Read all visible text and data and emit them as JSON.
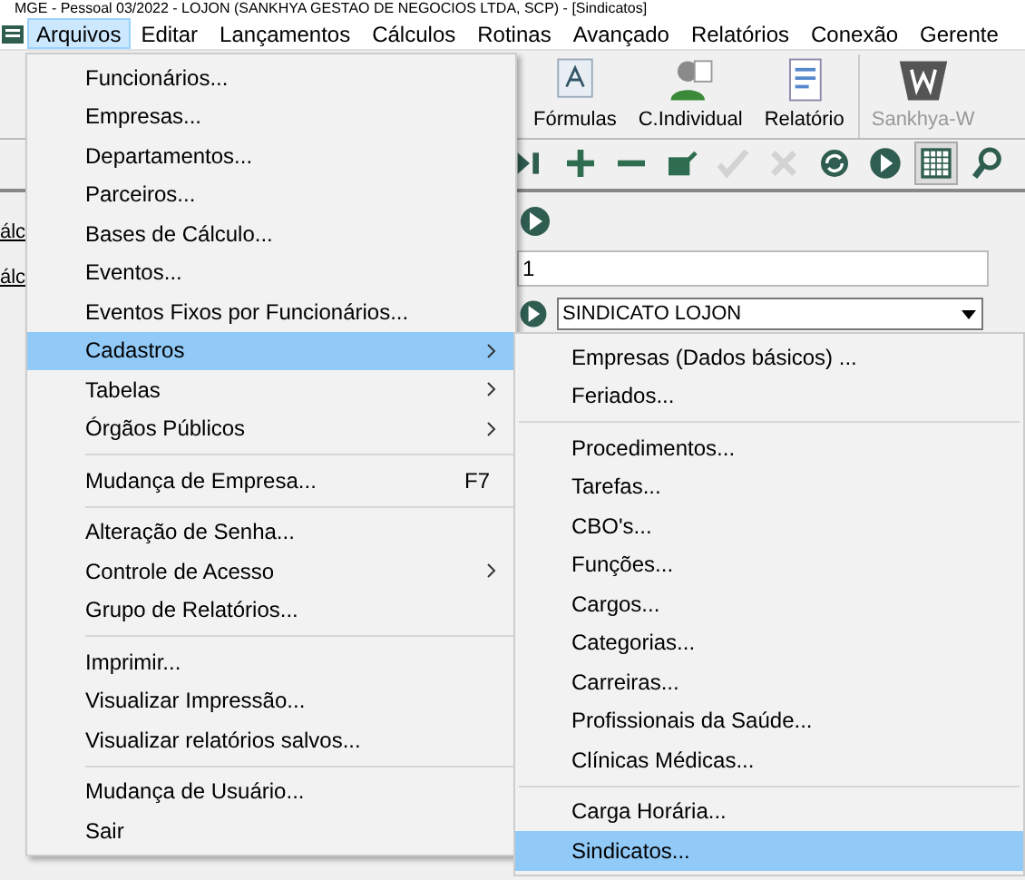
{
  "window": {
    "title": "MGE - Pessoal 03/2022 - LOJON (SANKHYA GESTAO DE NEGOCIOS LTDA, SCP) - [Sindicatos]"
  },
  "menu_bar": [
    {
      "label": "Arquivos",
      "selected": true
    },
    {
      "label": "Editar",
      "selected": false
    },
    {
      "label": "Lançamentos",
      "selected": false
    },
    {
      "label": "Cálculos",
      "selected": false
    },
    {
      "label": "Rotinas",
      "selected": false
    },
    {
      "label": "Avançado",
      "selected": false
    },
    {
      "label": "Relatórios",
      "selected": false
    },
    {
      "label": "Conexão",
      "selected": false
    },
    {
      "label": "Gerente",
      "selected": false
    }
  ],
  "toolbar": {
    "buttons": [
      {
        "kind": "formula",
        "label": "Fórmulas",
        "disabled": false
      },
      {
        "kind": "person",
        "label": "C.Individual",
        "disabled": false
      },
      {
        "kind": "report",
        "label": "Relatório",
        "disabled": false
      },
      {
        "kind": "logo",
        "label": "Sankhya-W",
        "disabled": true
      }
    ]
  },
  "nav_toolbar": [
    {
      "kind": "last",
      "disabled": false,
      "selected": false
    },
    {
      "kind": "add",
      "disabled": false,
      "selected": false
    },
    {
      "kind": "remove",
      "disabled": false,
      "selected": false
    },
    {
      "kind": "edit",
      "disabled": false,
      "selected": false
    },
    {
      "kind": "confirm",
      "disabled": true,
      "selected": false
    },
    {
      "kind": "cancel",
      "disabled": true,
      "selected": false
    },
    {
      "kind": "refresh",
      "disabled": false,
      "selected": false
    },
    {
      "kind": "play",
      "disabled": false,
      "selected": false
    },
    {
      "kind": "grid",
      "disabled": false,
      "selected": true
    },
    {
      "kind": "search",
      "disabled": false,
      "selected": false
    }
  ],
  "side_links": [
    "álc",
    "álc"
  ],
  "form": {
    "code_value": "1",
    "union_combo": "SINDICATO LOJON"
  },
  "file_menu": [
    {
      "kind": "item",
      "label": "Funcionários...",
      "selected": false
    },
    {
      "kind": "item",
      "label": "Empresas...",
      "selected": false
    },
    {
      "kind": "item",
      "label": "Departamentos...",
      "selected": false
    },
    {
      "kind": "item",
      "label": "Parceiros...",
      "selected": false
    },
    {
      "kind": "item",
      "label": "Bases de Cálculo...",
      "selected": false
    },
    {
      "kind": "item",
      "label": "Eventos...",
      "selected": false
    },
    {
      "kind": "item",
      "label": "Eventos Fixos por Funcionários...",
      "selected": false
    },
    {
      "kind": "submenu",
      "label": "Cadastros",
      "selected": true
    },
    {
      "kind": "submenu",
      "label": "Tabelas",
      "selected": false
    },
    {
      "kind": "submenu",
      "label": "Órgãos Públicos",
      "selected": false
    },
    {
      "kind": "separator"
    },
    {
      "kind": "item",
      "label": "Mudança de Empresa...",
      "shortcut": "F7",
      "selected": false
    },
    {
      "kind": "separator"
    },
    {
      "kind": "item",
      "label": "Alteração de Senha...",
      "selected": false
    },
    {
      "kind": "submenu",
      "label": "Controle de Acesso",
      "selected": false
    },
    {
      "kind": "item",
      "label": "Grupo de Relatórios...",
      "selected": false
    },
    {
      "kind": "separator"
    },
    {
      "kind": "item",
      "label": "Imprimir...",
      "selected": false
    },
    {
      "kind": "item",
      "label": "Visualizar Impressão...",
      "selected": false
    },
    {
      "kind": "item",
      "label": "Visualizar relatórios salvos...",
      "selected": false
    },
    {
      "kind": "separator"
    },
    {
      "kind": "item",
      "label": "Mudança de Usuário...",
      "selected": false
    },
    {
      "kind": "item",
      "label": "Sair",
      "selected": false
    }
  ],
  "cadastros_submenu": [
    {
      "kind": "item",
      "label": "Empresas (Dados básicos) ...",
      "selected": false
    },
    {
      "kind": "item",
      "label": "Feriados...",
      "selected": false
    },
    {
      "kind": "separator"
    },
    {
      "kind": "item",
      "label": "Procedimentos...",
      "selected": false
    },
    {
      "kind": "item",
      "label": "Tarefas...",
      "selected": false
    },
    {
      "kind": "item",
      "label": "CBO's...",
      "selected": false
    },
    {
      "kind": "item",
      "label": "Funções...",
      "selected": false
    },
    {
      "kind": "item",
      "label": "Cargos...",
      "selected": false
    },
    {
      "kind": "item",
      "label": "Categorias...",
      "selected": false
    },
    {
      "kind": "item",
      "label": "Carreiras...",
      "selected": false
    },
    {
      "kind": "item",
      "label": "Profissionais da Saúde...",
      "selected": false
    },
    {
      "kind": "item",
      "label": "Clínicas Médicas...",
      "selected": false
    },
    {
      "kind": "separator"
    },
    {
      "kind": "item",
      "label": "Carga Horária...",
      "selected": false
    },
    {
      "kind": "item",
      "label": "Sindicatos...",
      "selected": true
    }
  ]
}
